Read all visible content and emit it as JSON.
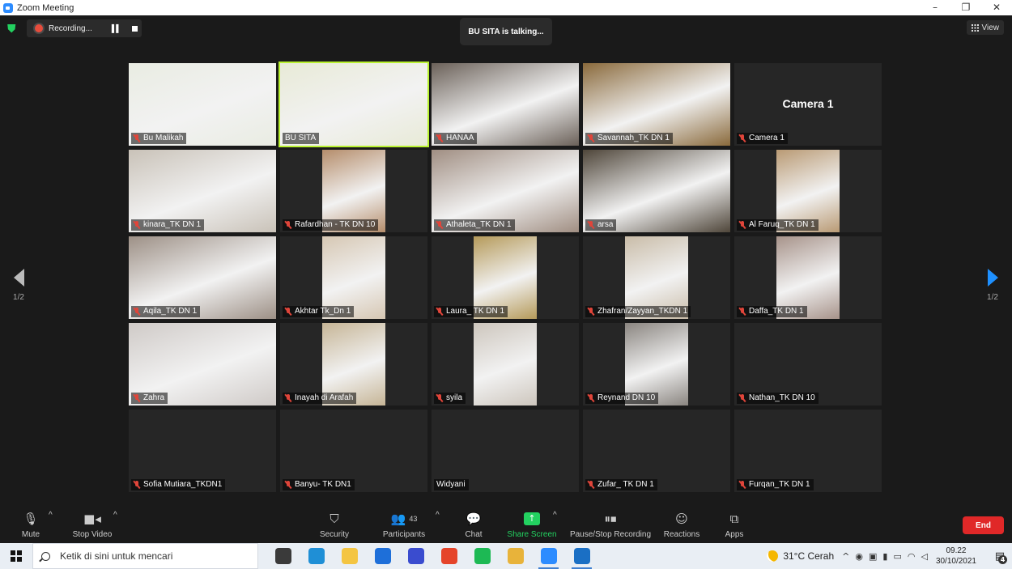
{
  "window": {
    "title": "Zoom Meeting",
    "controls": [
      "–",
      "❐",
      "✕"
    ]
  },
  "meeting": {
    "recording_label": "Recording...",
    "talking_label": "BU SITA is talking...",
    "view_label": "View",
    "page_left": "1/2",
    "page_right": "1/2",
    "active_speaker": "BU SITA",
    "camera_tile_label": "Camera 1",
    "participants": [
      {
        "name": "Bu Malikah",
        "muted": true,
        "video": "full",
        "color": "#e9ece2"
      },
      {
        "name": "BU SITA",
        "muted": false,
        "video": "full",
        "color": "#e8ead7"
      },
      {
        "name": "HANAA",
        "muted": true,
        "video": "full",
        "color": "#6b6159"
      },
      {
        "name": "Savannah_TK DN 1",
        "muted": true,
        "video": "full",
        "color": "#8a6a3c"
      },
      {
        "name": "Camera 1",
        "muted": true,
        "video": "none",
        "color": "#262626"
      },
      {
        "name": "kinara_TK DN 1",
        "muted": true,
        "video": "full",
        "color": "#c9c2b8"
      },
      {
        "name": "Rafardhan - TK DN 10",
        "muted": true,
        "video": "narrow",
        "color": "#b58d6b"
      },
      {
        "name": "Athaleta_TK DN 1",
        "muted": true,
        "video": "full",
        "color": "#a08e82"
      },
      {
        "name": "arsa",
        "muted": true,
        "video": "full",
        "color": "#4f463a"
      },
      {
        "name": "Al Faruq_TK DN 1",
        "muted": true,
        "video": "narrow",
        "color": "#b99a74"
      },
      {
        "name": "Aqila_TK DN 1",
        "muted": true,
        "video": "full",
        "color": "#9d9086"
      },
      {
        "name": "Akhtar Tk_Dn 1",
        "muted": true,
        "video": "narrow",
        "color": "#d6c7b3"
      },
      {
        "name": "Laura_ TK DN 1",
        "muted": true,
        "video": "narrow",
        "color": "#b59a5a"
      },
      {
        "name": "Zhafran/Zayyan_TKDN 1",
        "muted": true,
        "video": "narrow",
        "color": "#c9bca8"
      },
      {
        "name": "Daffa_TK DN 1",
        "muted": true,
        "video": "narrow",
        "color": "#a7938a"
      },
      {
        "name": "Zahra",
        "muted": true,
        "video": "full",
        "color": "#cfcac7"
      },
      {
        "name": "Inayah di Arafah",
        "muted": true,
        "video": "narrow",
        "color": "#c6b596"
      },
      {
        "name": "syila",
        "muted": true,
        "video": "narrow",
        "color": "#cdc6bd"
      },
      {
        "name": "Reynand DN 10",
        "muted": true,
        "video": "narrow",
        "color": "#8a8580"
      },
      {
        "name": "Nathan_TK DN 10",
        "muted": true,
        "video": "none",
        "color": "#262626"
      },
      {
        "name": "Sofia Mutiara_TKDN1",
        "muted": true,
        "video": "none",
        "color": "#262626"
      },
      {
        "name": "Banyu- TK DN1",
        "muted": true,
        "video": "none",
        "color": "#262626"
      },
      {
        "name": "Widyani",
        "muted": false,
        "video": "none",
        "color": "#262626"
      },
      {
        "name": "Zufar_ TK DN 1",
        "muted": true,
        "video": "none",
        "color": "#262626"
      },
      {
        "name": "Furqan_TK DN 1",
        "muted": true,
        "video": "none",
        "color": "#262626"
      }
    ]
  },
  "toolbar": {
    "mute": "Mute",
    "stop_video": "Stop Video",
    "security": "Security",
    "participants": "Participants",
    "participants_count": "43",
    "chat": "Chat",
    "share_screen": "Share Screen",
    "pause_stop_recording": "Pause/Stop Recording",
    "reactions": "Reactions",
    "apps": "Apps",
    "end": "End"
  },
  "taskbar": {
    "search_placeholder": "Ketik di sini untuk mencari",
    "weather": "31°C  Cerah",
    "time": "09.22",
    "date": "30/10/2021",
    "notifications": "4",
    "apps": [
      {
        "name": "task-view",
        "color": "#3a3a3a"
      },
      {
        "name": "edge",
        "color": "#1f8fd6"
      },
      {
        "name": "file-explorer",
        "color": "#f4c542"
      },
      {
        "name": "mail",
        "color": "#1e6fd9"
      },
      {
        "name": "pen-app",
        "color": "#3a4ccf"
      },
      {
        "name": "office",
        "color": "#e5442a"
      },
      {
        "name": "spotify",
        "color": "#1db954"
      },
      {
        "name": "chrome",
        "color": "#e8b33a"
      },
      {
        "name": "zoom",
        "color": "#2d8cff"
      },
      {
        "name": "media-player",
        "color": "#1a6fc4"
      }
    ]
  }
}
